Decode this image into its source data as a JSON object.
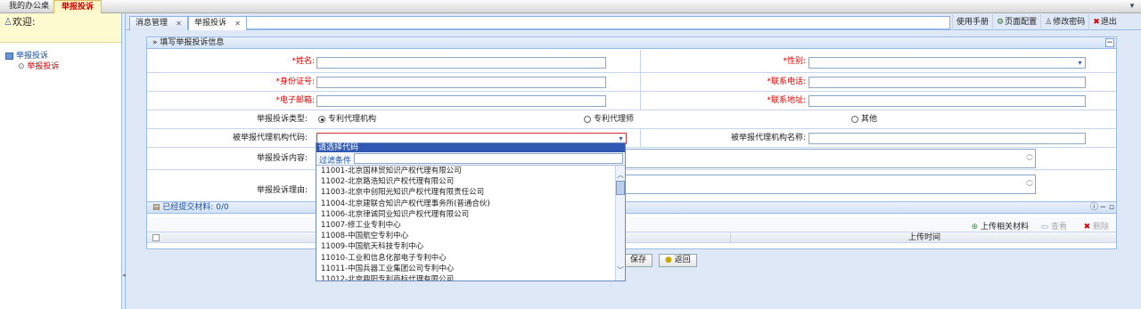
{
  "top_tabs": [
    "我的办公桌",
    "举报投诉"
  ],
  "welcome": "欢迎:",
  "tree": {
    "root": "举报投诉",
    "child": "举报投诉"
  },
  "main_tabs": [
    "消息管理",
    "举报投诉"
  ],
  "toolbar": [
    "使用手册",
    "页面配置",
    "修改密码",
    "退出"
  ],
  "form": {
    "title": "填写举报投诉信息",
    "name_label": "*姓名:",
    "gender_label": "*性别:",
    "id_label": "*身份证号:",
    "phone_label": "*联系电话:",
    "email_label": "*电子邮箱:",
    "address_label": "*联系地址:",
    "type_label": "举报投诉类型:",
    "type_options": [
      "专利代理机构",
      "专利代理师",
      "其他"
    ],
    "agency_code_label": "被举报代理机构代码:",
    "agency_name_label": "被举报代理机构名称:",
    "content_label": "举报投诉内容:",
    "reason_label": "举报投诉理由:"
  },
  "attachments": {
    "title": "已经提交材料: 0/0",
    "upload": "上传相关材料",
    "view": "查看",
    "delete": "删除",
    "col_upload_time": "上传时间"
  },
  "buttons": {
    "save": "保存",
    "back": "返回"
  },
  "dropdown": {
    "header": "请选择代码",
    "filter_label": "过滤条件",
    "items": [
      "11001-北京国林贸知识产权代理有限公司",
      "11002-北京路浩知识产权代理有限公司",
      "11003-北京中创阳光知识产权代理有限责任公司",
      "11004-北京建联合知识产权代理事务所(普通合伙)",
      "11006-北京律诚同业知识产权代理有限公司",
      "11007-修工业专利中心",
      "11008-中国航空专利中心",
      "11009-中国航天科技专利中心",
      "11010-工业和信息化部电子专利中心",
      "11011-中国兵器工业集团公司专利中心",
      "11012-北京鼎阳专利商标代理有限公司"
    ]
  }
}
